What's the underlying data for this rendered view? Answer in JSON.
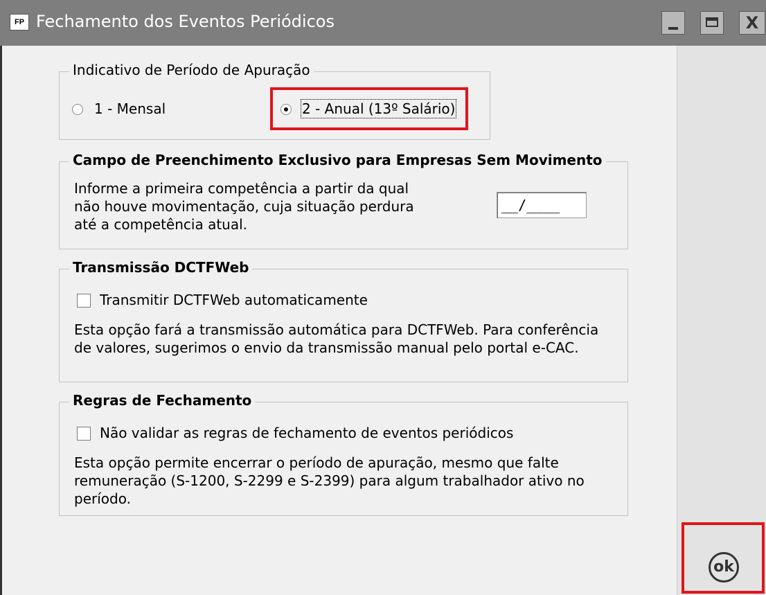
{
  "window": {
    "icon_text": "FP",
    "title": "Fechamento dos Eventos Periódicos",
    "close_glyph": "X"
  },
  "periodo": {
    "legend": "Indicativo de Período de Apuração",
    "options": [
      {
        "label": "1 - Mensal",
        "checked": false
      },
      {
        "label": "2 - Anual (13º Salário)",
        "checked": true
      }
    ]
  },
  "sem_movimento": {
    "legend": "Campo de Preenchimento Exclusivo para Empresas Sem Movimento",
    "lines": [
      "Informe a primeira competência a partir da qual",
      "não houve movimentação, cuja situação perdura",
      "até a competência atual."
    ],
    "competencia_value": "__/____"
  },
  "dctfweb": {
    "legend": "Transmissão DCTFWeb",
    "checkbox_label": "Transmitir DCTFWeb automaticamente",
    "checked": false,
    "lines": [
      "Esta opção fará a transmissão automática para DCTFWeb. Para conferência",
      "de valores, sugerimos o envio da transmissão manual pelo portal e-CAC."
    ]
  },
  "regras": {
    "legend": "Regras de Fechamento",
    "checkbox_label": "Não validar as regras de fechamento de eventos periódicos",
    "checked": false,
    "lines": [
      "Esta opção permite encerrar o período de apuração, mesmo que falte",
      "remuneração (S-1200, S-2299 e S-2399) para algum trabalhador ativo no",
      "período."
    ]
  },
  "ok_button": {
    "label": "ok"
  },
  "colors": {
    "highlight": "#e0151b",
    "titlebar": "#7e7e7e"
  }
}
